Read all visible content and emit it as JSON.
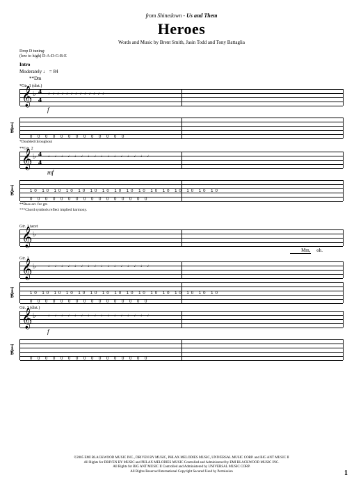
{
  "header": {
    "from_prefix": "from Shinedown - ",
    "album": "Us and Them",
    "title": "Heroes",
    "credits": "Words and Music by Brent Smith, Jasin Todd and Tony Battaglia"
  },
  "tuning": {
    "line1": "Drop D tuning:",
    "line2": "(low to high) D-A-D-G-B-E"
  },
  "intro": {
    "section": "Intro",
    "tempo": "Moderately ♩ = 84",
    "chord": "**Dm"
  },
  "gtr1": {
    "label": "*Gtr. 1 (dist.)",
    "dynamic": "f",
    "tab_low": "0",
    "tab_pattern": "0 0 0 0 0 0 0 0 0 0 0 0 0",
    "footnote": "*Doubled throughout"
  },
  "gtr2": {
    "label": "**Gtr. 2",
    "dynamic": "mf",
    "tab_mid": "10 10 10 10 10 10 10 10 10 10 10 10 10 10 10 10",
    "tab_low": "0  0  0  0  0  0  0  0  0  0  0  0  0  0  0  0",
    "footnote1": "**Bass arr. for gtr.",
    "footnote2": "***Chord symbols reflect implied harmony."
  },
  "system2": {
    "gtr1_tacet": "Gtr. 1 tacet",
    "lyric_mm": "Mm,",
    "lyric_oh": "oh.",
    "gtr2_label": "Gtr. 2",
    "gtr2_tab_mid": "10 10 10 10 10 10 10 10 10 10 10 10 10 10 10 10",
    "gtr2_tab_low": "0  0  0  0  0  0  0  0  0  0  0  0  0  0  0  0",
    "gtr3_label": "Gtr. 3 (dist.)",
    "gtr3_dynamic": "f",
    "gtr3_tab": "0  0  0  0  0  0  0  0  0  0  0  0  0  0  0  0"
  },
  "copyright": {
    "line1": "©2005 EMI BLACKWOOD MUSIC INC., DRIVEN BY MUSIC, PHLAX MELODIES MUSIC, UNIVERSAL MUSIC CORP. and BIG ANT MUSIC II",
    "line2": "All Rights for DRIVEN BY MUSIC and PHLAX MELODIES MUSIC Controlled and Administered by EMI BLACKWOOD MUSIC INC.",
    "line3": "All Rights for BIG ANT MUSIC II Controlled and Administered by UNIVERSAL MUSIC CORP.",
    "line4": "All Rights Reserved   International Copyright Secured   Used by Permission"
  },
  "page_number": "1"
}
